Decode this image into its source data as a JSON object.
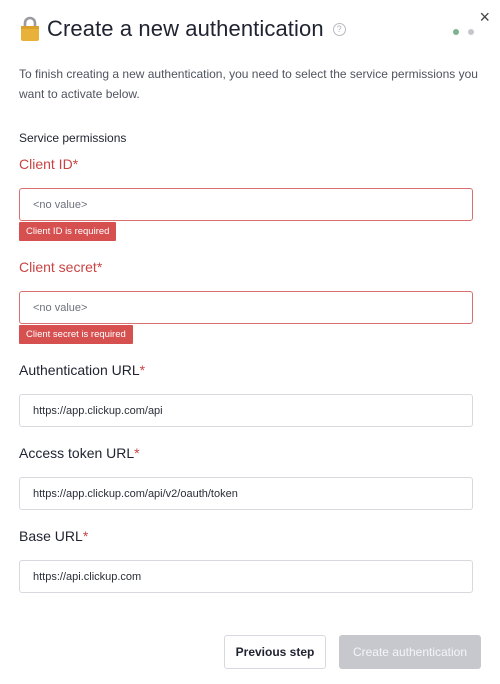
{
  "header": {
    "title": "Create a new authentication",
    "help_glyph": "?",
    "close_glyph": "×"
  },
  "intro": "To finish creating a new authentication, you need to select the service permissions you want to activate below.",
  "section_title": "Service permissions",
  "fields": {
    "client_id": {
      "label": "Client ID",
      "required_mark": "*",
      "value": "<no value>",
      "error": "Client ID is required"
    },
    "client_secret": {
      "label": "Client secret",
      "required_mark": "*",
      "value": "<no value>",
      "error": "Client secret is required"
    },
    "auth_url": {
      "label": "Authentication URL",
      "required_mark": "*",
      "value": "https://app.clickup.com/api"
    },
    "token_url": {
      "label": "Access token URL",
      "required_mark": "*",
      "value": "https://app.clickup.com/api/v2/oauth/token"
    },
    "base_url": {
      "label": "Base URL",
      "required_mark": "*",
      "value": "https://api.clickup.com"
    }
  },
  "steps": {
    "current": 1,
    "total": 2
  },
  "buttons": {
    "previous": "Previous step",
    "create": "Create authentication"
  },
  "colors": {
    "error": "#d65050",
    "active_step": "#7fb28f",
    "disabled_button": "#c6c8cd"
  },
  "icons": {
    "header": "lock-icon",
    "help": "help-circle-icon",
    "close": "close-icon"
  }
}
